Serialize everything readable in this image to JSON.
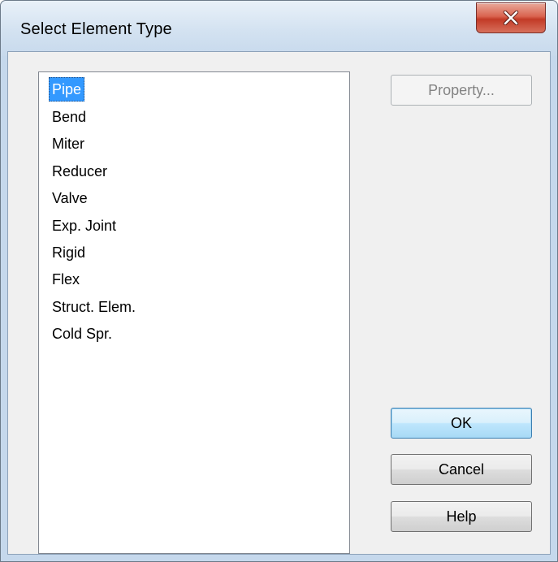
{
  "window": {
    "title": "Select Element Type"
  },
  "list": {
    "items": [
      {
        "label": "Pipe",
        "selected": true
      },
      {
        "label": "Bend",
        "selected": false
      },
      {
        "label": "Miter",
        "selected": false
      },
      {
        "label": "Reducer",
        "selected": false
      },
      {
        "label": "Valve",
        "selected": false
      },
      {
        "label": "Exp. Joint",
        "selected": false
      },
      {
        "label": "Rigid",
        "selected": false
      },
      {
        "label": "Flex",
        "selected": false
      },
      {
        "label": "Struct. Elem.",
        "selected": false
      },
      {
        "label": "Cold Spr.",
        "selected": false
      }
    ]
  },
  "buttons": {
    "property_label": "Property...",
    "property_enabled": false,
    "ok_label": "OK",
    "cancel_label": "Cancel",
    "help_label": "Help"
  },
  "colors": {
    "selection": "#3399ff",
    "close_button": "#c23a26"
  }
}
